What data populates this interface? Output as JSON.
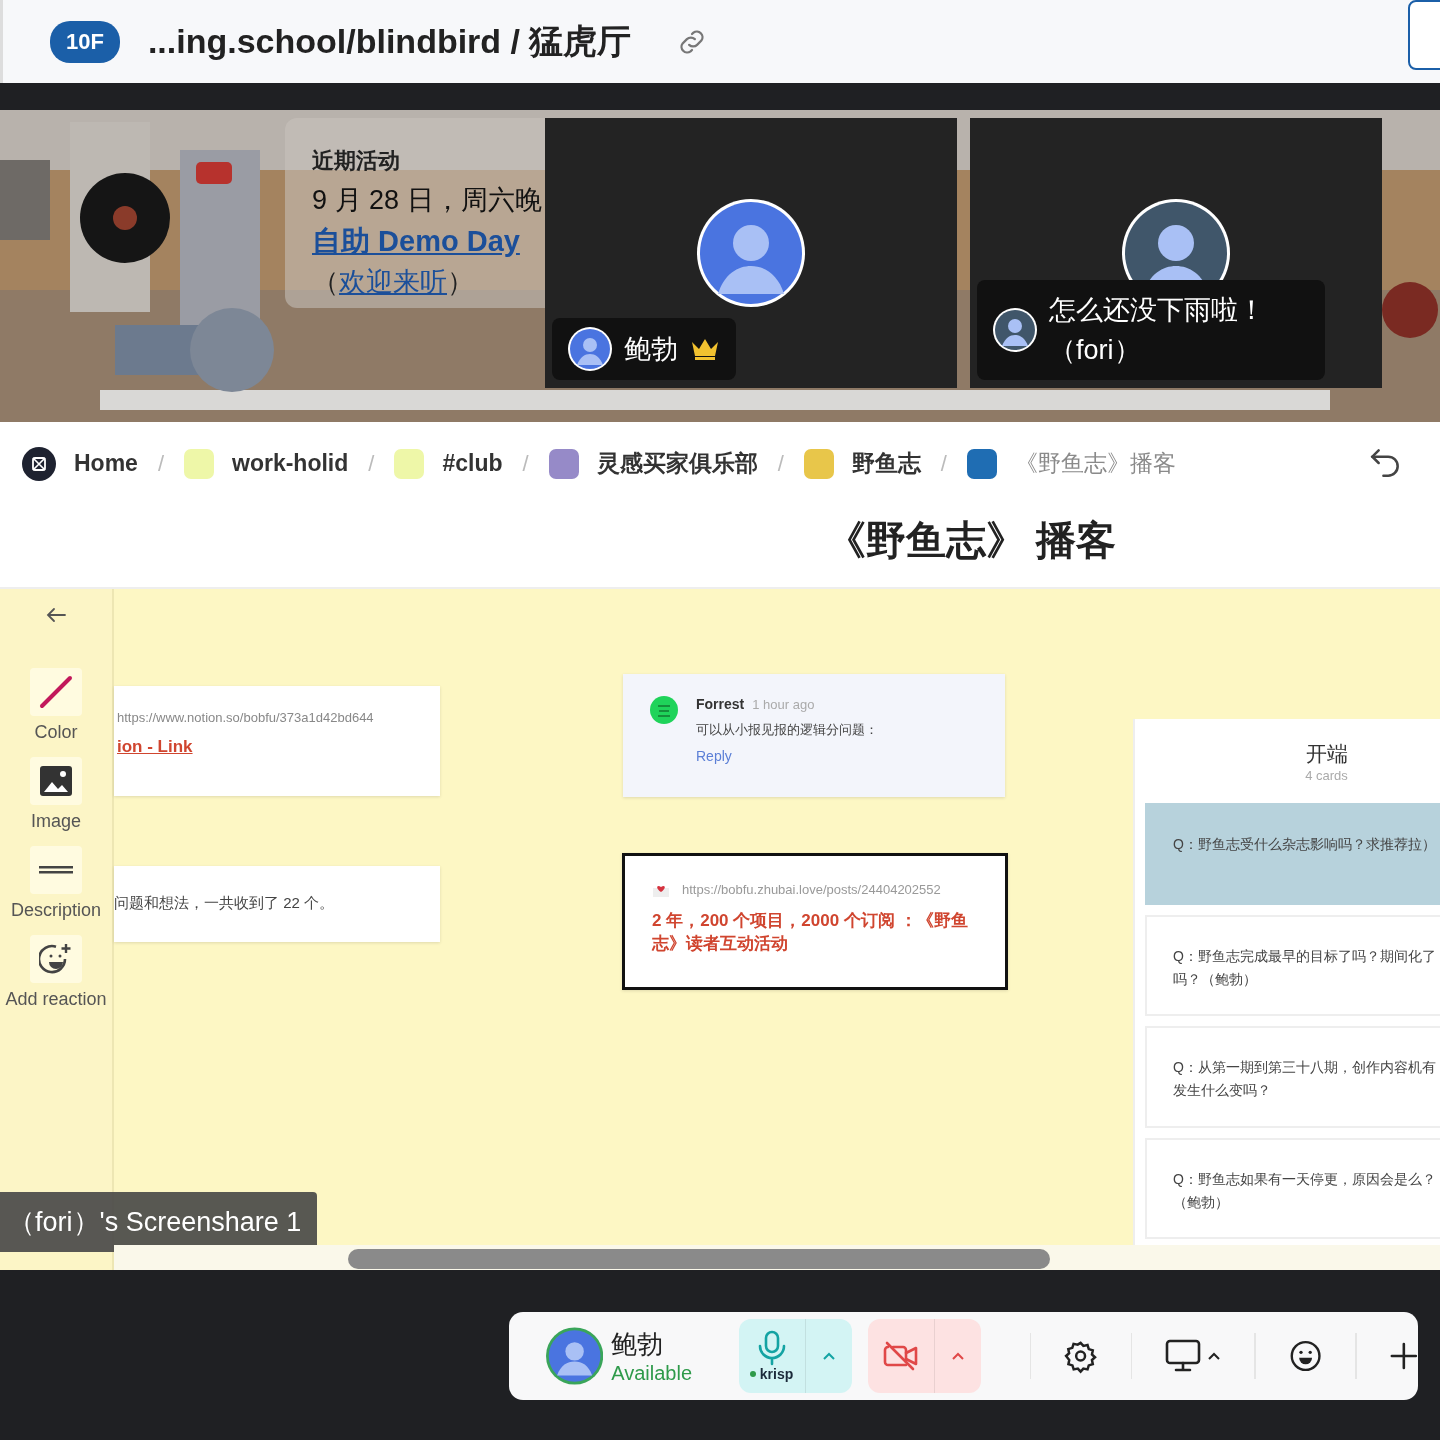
{
  "header": {
    "floor": "10F",
    "title": "...ing.school/blindbird / 猛虎厅"
  },
  "scene": {
    "event": {
      "heading": "近期活动",
      "date": "9 月 28 日，周六晚",
      "link": "自助 Demo Day",
      "note_before": "（",
      "note_link": "欢迎来听",
      "note_after": "）"
    },
    "tiles": [
      {
        "name": "鲍勃",
        "host": true
      },
      {
        "name": "怎么还没下雨啦！（fori）",
        "host": false
      }
    ]
  },
  "share": {
    "breadcrumb": {
      "separator": "/",
      "items": [
        {
          "kind": "home",
          "label": "Home",
          "current": false
        },
        {
          "kind": "board",
          "label": "work-holid",
          "color": "#eef7a8",
          "current": false
        },
        {
          "kind": "board",
          "label": "#club",
          "color": "#eef7a8",
          "current": false
        },
        {
          "kind": "board",
          "label": "灵感买家俱乐部",
          "color": "#968ac8",
          "current": false
        },
        {
          "kind": "board",
          "label": "野鱼志",
          "color": "#e8c64a",
          "current": false
        },
        {
          "kind": "board",
          "label": "《野鱼志》播客",
          "color": "#1f6db3",
          "current": true
        }
      ]
    },
    "page_title": "《野鱼志》 播客",
    "toolbar": [
      {
        "kind": "color",
        "label": "Color"
      },
      {
        "kind": "image",
        "label": "Image"
      },
      {
        "kind": "description",
        "label": "Description"
      },
      {
        "kind": "reaction",
        "label": "Add reaction"
      }
    ],
    "board": {
      "link_card": {
        "url": "https://www.notion.so/bobfu/373a1d42bd644",
        "title": "ion - Link"
      },
      "text_card": {
        "text": "问题和想法，一共收到了 22 个。"
      },
      "comment": {
        "author": "Forrest",
        "time": "1 hour ago",
        "text": "可以从小报见报的逻辑分问题：",
        "reply": "Reply"
      },
      "bookmark": {
        "url": "https://bobfu.zhubai.love/posts/24404202552",
        "title": "2 年，200 个项目，2000 个订阅 ：《野鱼志》读者互动活动"
      },
      "column": {
        "title": "开端",
        "count": "4 cards",
        "cards": [
          {
            "text": "Q：野鱼志受什么杂志影响吗？求推荐拉）",
            "selected": true
          },
          {
            "text": "Q：野鱼志完成最早的目标了吗？期间化了吗？（鲍勃）",
            "selected": false
          },
          {
            "text": "Q：从第一期到第三十八期，创作内容机有发生什么变吗？",
            "selected": false
          },
          {
            "text": "Q：野鱼志如果有一天停更，原因会是么？（鲍勃）",
            "selected": false
          }
        ]
      }
    },
    "label": "（fori）'s Screenshare 1"
  },
  "controls": {
    "user": {
      "name": "鲍勃",
      "status": "Available"
    },
    "mic": {
      "on": true,
      "badge": "krisp"
    },
    "camera": {
      "on": false
    }
  }
}
